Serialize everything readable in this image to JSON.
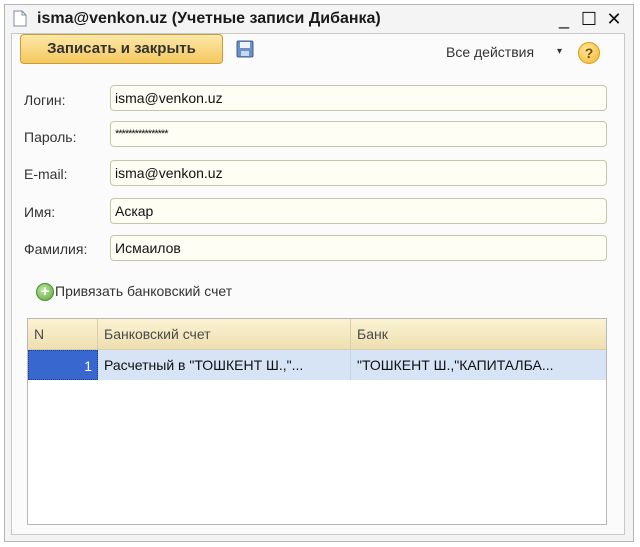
{
  "window": {
    "title": "isma@venkon.uz (Учетные записи Дибанка)",
    "icon": "document-icon",
    "controls": {
      "minimize": "_",
      "maximize": "☐",
      "close": "✕"
    }
  },
  "toolbar": {
    "save_close_label": "Записать и закрыть",
    "save_icon": "floppy-disk-icon",
    "actions_label": "Все действия",
    "actions_arrow": "▾",
    "help_label": "?"
  },
  "form": {
    "login": {
      "label": "Логин:",
      "value": "isma@venkon.uz"
    },
    "password": {
      "label": "Пароль:",
      "value": "****************"
    },
    "email": {
      "label": "E-mail:",
      "value": "isma@venkon.uz"
    },
    "first_name": {
      "label": "Имя:",
      "value": "Аскар"
    },
    "last_name": {
      "label": "Фамилия:",
      "value": "Исмаилов"
    }
  },
  "attach": {
    "label": "Привязать банковский счет",
    "icon": "plus-circle-icon"
  },
  "table": {
    "columns": [
      "N",
      "Банковский счет",
      "Банк"
    ],
    "rows": [
      {
        "n": "1",
        "account": "Расчетный в \"ТОШКЕНТ Ш.,\"...",
        "bank": "\"ТОШКЕНТ Ш.,\"КАПИТАЛБА..."
      }
    ]
  },
  "colors": {
    "accent": "#f4c85d",
    "selection": "#3967d0",
    "row_highlight": "#d6e4f6",
    "header": "#eedfb0"
  }
}
